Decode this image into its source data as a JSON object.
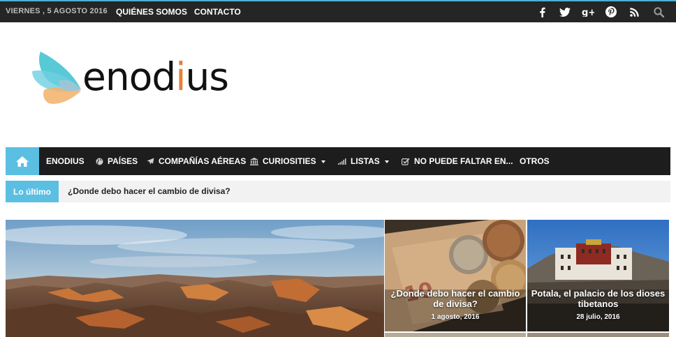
{
  "topbar": {
    "date": "VIERNES , 5 AGOSTO 2016",
    "links": [
      {
        "label": "QUIÉNES SOMOS"
      },
      {
        "label": "CONTACTO"
      }
    ],
    "social_icons": [
      "facebook-icon",
      "twitter-icon",
      "google-plus-icon",
      "pinterest-icon",
      "rss-icon",
      "search-icon"
    ]
  },
  "logo": {
    "prefix": "enod",
    "accent": "i",
    "suffix": "us"
  },
  "nav": {
    "home_icon": "home-icon",
    "items": [
      {
        "label": "ENODIUS",
        "icon": null,
        "dropdown": false
      },
      {
        "label": "PAÍSES",
        "icon": "globe-icon",
        "dropdown": false
      },
      {
        "label": "COMPAÑÍAS AÉREAS",
        "icon": "plane-icon",
        "dropdown": false
      },
      {
        "label": "CURIOSITIES",
        "icon": "bank-icon",
        "dropdown": true
      },
      {
        "label": "LISTAS",
        "icon": "signal-icon",
        "dropdown": true
      },
      {
        "label": "NO PUEDE FALTAR EN...",
        "icon": "checkbox-icon",
        "dropdown": false
      },
      {
        "label": "OTROS",
        "icon": null,
        "dropdown": false
      }
    ]
  },
  "ticker": {
    "tag": "Lo último",
    "headline": "¿Donde debo hacer el cambio de divisa?"
  },
  "features": [
    {
      "title": "",
      "date": "",
      "image": "grand-canyon-landscape"
    },
    {
      "title": "¿Donde debo hacer el cambio de divisa?",
      "date": "1 agosto, 2016",
      "image": "euro-coins-and-banknotes"
    },
    {
      "title": "Potala, el palacio de los dioses tibetanos",
      "date": "28 julio, 2016",
      "image": "potala-palace"
    }
  ],
  "colors": {
    "accent": "#5bbfe2",
    "topbar_bg": "#252525",
    "nav_bg": "#1d1d1d",
    "logo_accent": "#e8803a"
  }
}
